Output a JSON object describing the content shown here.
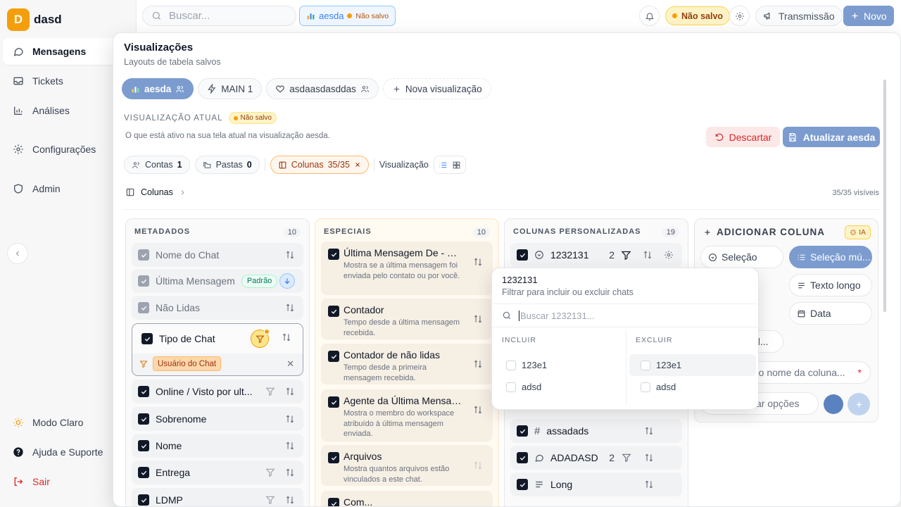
{
  "brand": {
    "initial": "D",
    "name": "dasd"
  },
  "nav": {
    "items": [
      {
        "label": "Mensagens"
      },
      {
        "label": "Tickets"
      },
      {
        "label": "Análises"
      },
      {
        "label": "Configurações"
      },
      {
        "label": "Admin"
      }
    ],
    "bottom": [
      {
        "label": "Modo Claro"
      },
      {
        "label": "Ajuda e Suporte"
      },
      {
        "label": "Sair"
      }
    ]
  },
  "topbar": {
    "search_placeholder": "Buscar...",
    "view_name": "aesda",
    "view_status": "Não salvo",
    "unsaved": "Não salvo",
    "broadcast": "Transmissão",
    "new": "Novo"
  },
  "panel": {
    "title": "Visualizações",
    "subtitle": "Layouts de tabela salvos",
    "tabs": [
      {
        "label": "aesda"
      },
      {
        "label": "MAIN 1"
      },
      {
        "label": "asdaasdasddas"
      },
      {
        "label": "Nova visualização"
      }
    ],
    "current_label": "VISUALIZAÇÃO ATUAL",
    "current_status": "Não salvo",
    "current_desc": "O que está ativo na sua tela atual na visualização aesda.",
    "discard": "Descartar",
    "update": "Atualizar aesda",
    "filters": {
      "contas_label": "Contas",
      "contas_count": "1",
      "pastas_label": "Pastas",
      "pastas_count": "0",
      "colunas_label": "Colunas",
      "colunas_count": "35/35",
      "view_label": "Visualização"
    },
    "breadcrumb": "Colunas",
    "visible_count": "35/35 visíveis"
  },
  "metadados": {
    "title": "METADADOS",
    "count": "10",
    "badge": "Padrão",
    "tipo_label": "Tipo de Chat",
    "tipo_tag": "Usuário do Chat",
    "rows": [
      "Nome do Chat",
      "Última Mensagem",
      "Não Lidas",
      "Online / Visto por ult...",
      "Sobrenome",
      "Nome",
      "Entrega",
      "LDMP"
    ]
  },
  "especiais": {
    "title": "ESPECIAIS",
    "count": "10",
    "rows": [
      {
        "title": "Última Mensagem De - Us...",
        "desc": "Mostra se a última mensagem foi enviada pelo contato ou por você."
      },
      {
        "title": "Contador",
        "desc": "Tempo desde a última mensagem recebida."
      },
      {
        "title": "Contador de não lidas",
        "desc": "Tempo desde a primeira mensagem recebida."
      },
      {
        "title": "Agente da Última Mensag...",
        "desc": "Mostra o membro do workspace atribuído à última mensagem enviada."
      },
      {
        "title": "Arquivos",
        "desc": "Mostra quantos arquivos estão vinculados a este chat."
      },
      {
        "title": "Com...",
        "desc": ""
      }
    ]
  },
  "personalizadas": {
    "title": "COLUNAS PERSONALIZADAS",
    "count": "19",
    "rows": [
      {
        "label": "1232131",
        "num": "2"
      },
      {
        "label": "assadads",
        "num": ""
      },
      {
        "label": "ADADASD",
        "num": "2"
      },
      {
        "label": "Long",
        "num": ""
      }
    ]
  },
  "adicionar": {
    "title": "ADICIONAR COLUNA",
    "ia": "IA",
    "types": [
      {
        "label": "Seleção"
      },
      {
        "label": "Seleção mú..."
      },
      {
        "label": "Texto longo"
      },
      {
        "label": "Data"
      },
      {
        "label": "sel..."
      }
    ],
    "name_placeholder": "e o nome da coluna...",
    "required": "*",
    "options_placeholder": "ar opções"
  },
  "popover": {
    "title": "1232131",
    "subtitle": "Filtrar para incluir ou excluir chats",
    "search_placeholder": "Buscar 1232131...",
    "include_label": "INCLUIR",
    "exclude_label": "EXCLUIR",
    "include": [
      "123e1",
      "adsd"
    ],
    "exclude": [
      "123e1",
      "adsd"
    ]
  },
  "colors": {
    "accent": "#7c9ccf",
    "orange": "#f59e0b",
    "danger": "#dc2626"
  }
}
